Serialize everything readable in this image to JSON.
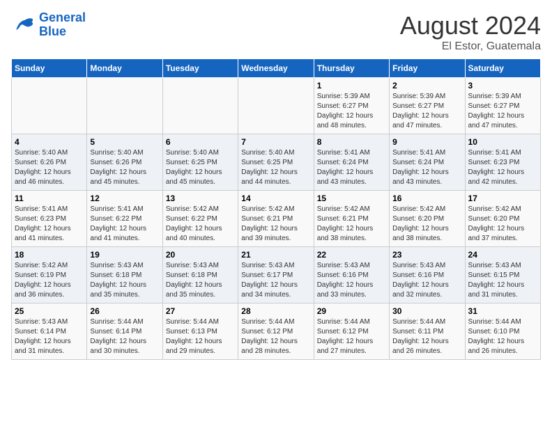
{
  "logo": {
    "line1": "General",
    "line2": "Blue"
  },
  "title": "August 2024",
  "subtitle": "El Estor, Guatemala",
  "weekdays": [
    "Sunday",
    "Monday",
    "Tuesday",
    "Wednesday",
    "Thursday",
    "Friday",
    "Saturday"
  ],
  "weeks": [
    [
      {
        "day": "",
        "info": ""
      },
      {
        "day": "",
        "info": ""
      },
      {
        "day": "",
        "info": ""
      },
      {
        "day": "",
        "info": ""
      },
      {
        "day": "1",
        "info": "Sunrise: 5:39 AM\nSunset: 6:27 PM\nDaylight: 12 hours\nand 48 minutes."
      },
      {
        "day": "2",
        "info": "Sunrise: 5:39 AM\nSunset: 6:27 PM\nDaylight: 12 hours\nand 47 minutes."
      },
      {
        "day": "3",
        "info": "Sunrise: 5:39 AM\nSunset: 6:27 PM\nDaylight: 12 hours\nand 47 minutes."
      }
    ],
    [
      {
        "day": "4",
        "info": "Sunrise: 5:40 AM\nSunset: 6:26 PM\nDaylight: 12 hours\nand 46 minutes."
      },
      {
        "day": "5",
        "info": "Sunrise: 5:40 AM\nSunset: 6:26 PM\nDaylight: 12 hours\nand 45 minutes."
      },
      {
        "day": "6",
        "info": "Sunrise: 5:40 AM\nSunset: 6:25 PM\nDaylight: 12 hours\nand 45 minutes."
      },
      {
        "day": "7",
        "info": "Sunrise: 5:40 AM\nSunset: 6:25 PM\nDaylight: 12 hours\nand 44 minutes."
      },
      {
        "day": "8",
        "info": "Sunrise: 5:41 AM\nSunset: 6:24 PM\nDaylight: 12 hours\nand 43 minutes."
      },
      {
        "day": "9",
        "info": "Sunrise: 5:41 AM\nSunset: 6:24 PM\nDaylight: 12 hours\nand 43 minutes."
      },
      {
        "day": "10",
        "info": "Sunrise: 5:41 AM\nSunset: 6:23 PM\nDaylight: 12 hours\nand 42 minutes."
      }
    ],
    [
      {
        "day": "11",
        "info": "Sunrise: 5:41 AM\nSunset: 6:23 PM\nDaylight: 12 hours\nand 41 minutes."
      },
      {
        "day": "12",
        "info": "Sunrise: 5:41 AM\nSunset: 6:22 PM\nDaylight: 12 hours\nand 41 minutes."
      },
      {
        "day": "13",
        "info": "Sunrise: 5:42 AM\nSunset: 6:22 PM\nDaylight: 12 hours\nand 40 minutes."
      },
      {
        "day": "14",
        "info": "Sunrise: 5:42 AM\nSunset: 6:21 PM\nDaylight: 12 hours\nand 39 minutes."
      },
      {
        "day": "15",
        "info": "Sunrise: 5:42 AM\nSunset: 6:21 PM\nDaylight: 12 hours\nand 38 minutes."
      },
      {
        "day": "16",
        "info": "Sunrise: 5:42 AM\nSunset: 6:20 PM\nDaylight: 12 hours\nand 38 minutes."
      },
      {
        "day": "17",
        "info": "Sunrise: 5:42 AM\nSunset: 6:20 PM\nDaylight: 12 hours\nand 37 minutes."
      }
    ],
    [
      {
        "day": "18",
        "info": "Sunrise: 5:42 AM\nSunset: 6:19 PM\nDaylight: 12 hours\nand 36 minutes."
      },
      {
        "day": "19",
        "info": "Sunrise: 5:43 AM\nSunset: 6:18 PM\nDaylight: 12 hours\nand 35 minutes."
      },
      {
        "day": "20",
        "info": "Sunrise: 5:43 AM\nSunset: 6:18 PM\nDaylight: 12 hours\nand 35 minutes."
      },
      {
        "day": "21",
        "info": "Sunrise: 5:43 AM\nSunset: 6:17 PM\nDaylight: 12 hours\nand 34 minutes."
      },
      {
        "day": "22",
        "info": "Sunrise: 5:43 AM\nSunset: 6:16 PM\nDaylight: 12 hours\nand 33 minutes."
      },
      {
        "day": "23",
        "info": "Sunrise: 5:43 AM\nSunset: 6:16 PM\nDaylight: 12 hours\nand 32 minutes."
      },
      {
        "day": "24",
        "info": "Sunrise: 5:43 AM\nSunset: 6:15 PM\nDaylight: 12 hours\nand 31 minutes."
      }
    ],
    [
      {
        "day": "25",
        "info": "Sunrise: 5:43 AM\nSunset: 6:14 PM\nDaylight: 12 hours\nand 31 minutes."
      },
      {
        "day": "26",
        "info": "Sunrise: 5:44 AM\nSunset: 6:14 PM\nDaylight: 12 hours\nand 30 minutes."
      },
      {
        "day": "27",
        "info": "Sunrise: 5:44 AM\nSunset: 6:13 PM\nDaylight: 12 hours\nand 29 minutes."
      },
      {
        "day": "28",
        "info": "Sunrise: 5:44 AM\nSunset: 6:12 PM\nDaylight: 12 hours\nand 28 minutes."
      },
      {
        "day": "29",
        "info": "Sunrise: 5:44 AM\nSunset: 6:12 PM\nDaylight: 12 hours\nand 27 minutes."
      },
      {
        "day": "30",
        "info": "Sunrise: 5:44 AM\nSunset: 6:11 PM\nDaylight: 12 hours\nand 26 minutes."
      },
      {
        "day": "31",
        "info": "Sunrise: 5:44 AM\nSunset: 6:10 PM\nDaylight: 12 hours\nand 26 minutes."
      }
    ]
  ]
}
